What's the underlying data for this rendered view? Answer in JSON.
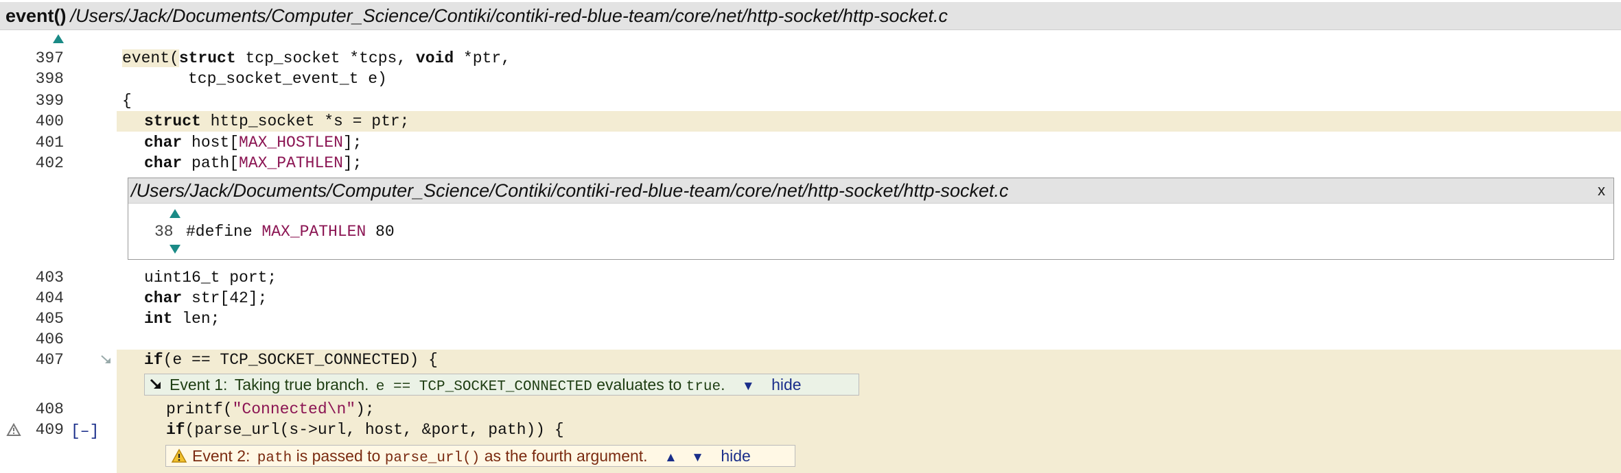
{
  "header": {
    "function": "event()",
    "path": "/Users/Jack/Documents/Computer_Science/Contiki/contiki-red-blue-team/core/net/http-socket/http-socket.c"
  },
  "lines": [
    {
      "num": "397"
    },
    {
      "num": "398"
    },
    {
      "num": "399"
    },
    {
      "num": "400"
    },
    {
      "num": "401"
    },
    {
      "num": "402"
    },
    {
      "num": "403"
    },
    {
      "num": "404"
    },
    {
      "num": "405"
    },
    {
      "num": "406"
    },
    {
      "num": "407"
    },
    {
      "num": "408"
    },
    {
      "num": "409"
    }
  ],
  "code": {
    "l397_fn": "event(",
    "l397_kw1": "struct",
    "l397_mid": " tcp_socket *tcps, ",
    "l397_kw2": "void",
    "l397_end": " *ptr,",
    "l398": "tcp_socket_event_t e)",
    "l399": "{",
    "l400_kw": "struct",
    "l400_rest": " http_socket *s = ptr;",
    "l401_kw": "char",
    "l401_a": " host[",
    "l401_mac": "MAX_HOSTLEN",
    "l401_b": "];",
    "l402_kw": "char",
    "l402_a": " path[",
    "l402_mac": "MAX_PATHLEN",
    "l402_b": "];",
    "l403": "uint16_t port;",
    "l404_kw": "char",
    "l404_rest": " str[42];",
    "l405_kw": "int",
    "l405_rest": " len;",
    "l407_kw": "if",
    "l407_rest": "(e == TCP_SOCKET_CONNECTED) {",
    "l408_a": "printf(",
    "l408_str": "\"Connected\\n\"",
    "l408_b": ");",
    "l409_kw": "if",
    "l409_rest": "(parse_url(s->url, host, &port, path)) {"
  },
  "popup": {
    "path": "/Users/Jack/Documents/Computer_Science/Contiki/contiki-red-blue-team/core/net/http-socket/http-socket.c",
    "close": "x",
    "line_num": "38",
    "directive": "#define ",
    "macro": "MAX_PATHLEN",
    "value": " 80"
  },
  "fold_toggle": "[–]",
  "event1": {
    "label": "Event 1:",
    "text1": "Taking true branch.",
    "code1": "e == TCP_SOCKET_CONNECTED",
    "text2": "evaluates to",
    "code2": "true",
    "text3": ".",
    "down_arrow": "▼",
    "hide": "hide"
  },
  "event2": {
    "label": "Event 2:",
    "code1": "path",
    "text1": "is passed to",
    "code2": "parse_url()",
    "text2": "as the fourth argument.",
    "up_arrow": "▲",
    "down_arrow": "▼",
    "hide": "hide"
  },
  "colors": {
    "highlight": "#f3ecd3",
    "macro": "#8b1553",
    "nav_arrow": "#1a8a86",
    "link": "#1a2e8a",
    "event1_bg": "#ebf2e6",
    "event2_bg": "#fff8e5"
  },
  "icons": [
    "nav-up-icon",
    "nav-down-icon",
    "jump-arrow-icon",
    "warning-icon",
    "close-icon"
  ]
}
